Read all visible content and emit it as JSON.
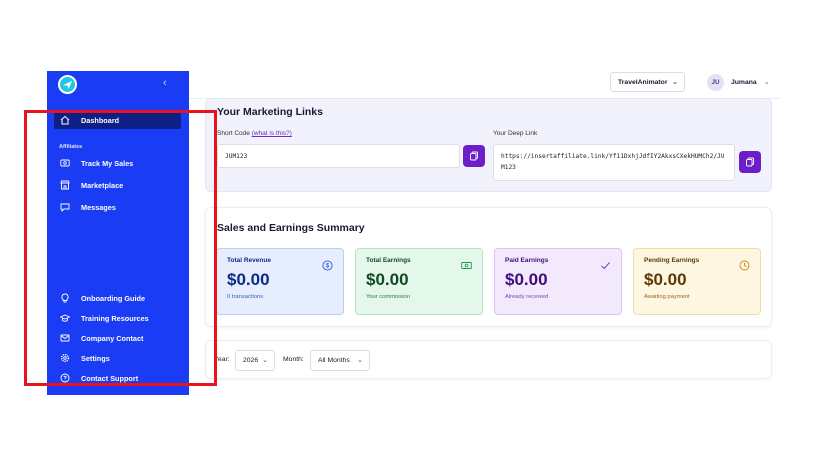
{
  "sidebar": {
    "section_label": "Affiliates",
    "items": [
      {
        "label": "Dashboard",
        "icon": "home-icon",
        "active": true
      },
      {
        "label": "Track My Sales",
        "icon": "dollar-sign-icon"
      },
      {
        "label": "Marketplace",
        "icon": "store-icon"
      },
      {
        "label": "Messages",
        "icon": "chat-icon"
      },
      {
        "label": "Onboarding Guide",
        "icon": "lightbulb-icon"
      },
      {
        "label": "Training Resources",
        "icon": "graduation-cap-icon"
      },
      {
        "label": "Company Contact",
        "icon": "mail-icon"
      },
      {
        "label": "Settings",
        "icon": "gear-icon"
      },
      {
        "label": "Contact Support",
        "icon": "help-circle-icon"
      }
    ]
  },
  "header": {
    "workspace": "TravelAnimator",
    "user_initials": "JU",
    "user_name": "Jumana"
  },
  "links": {
    "title": "Your Marketing Links",
    "short_code_label": "Short Code",
    "short_code_hint": "(what is this?)",
    "short_code_value": "JUM123",
    "deep_link_label": "Your Deep Link",
    "deep_link_value": "https://insertaffiliate.link/Yf11DxhjJdfIY2AkxsCXekHUMCh2/JUM123"
  },
  "summary": {
    "title": "Sales and Earnings Summary",
    "stats": [
      {
        "label": "Total Revenue",
        "value": "$0.00",
        "sub": "0 transactions",
        "icon": "dollar-circle-icon"
      },
      {
        "label": "Total Earnings",
        "value": "$0.00",
        "sub": "Your commission",
        "icon": "banknote-icon"
      },
      {
        "label": "Paid Earnings",
        "value": "$0.00",
        "sub": "Already received",
        "icon": "check-icon"
      },
      {
        "label": "Pending Earnings",
        "value": "$0.00",
        "sub": "Awaiting payment",
        "icon": "clock-icon"
      }
    ]
  },
  "filters": {
    "year_label": "Year:",
    "year_value": "2026",
    "month_label": "Month:",
    "month_value": "All Months"
  },
  "colors": {
    "sidebar": "#1a3cf5",
    "accent": "#6c1fc8",
    "annotation": "#e8141c"
  }
}
